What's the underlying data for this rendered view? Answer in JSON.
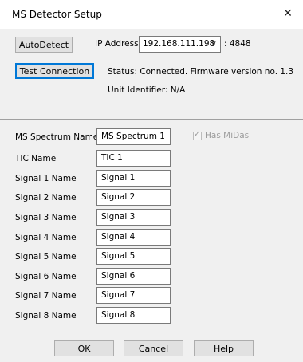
{
  "window": {
    "title": "MS Detector Setup",
    "close_glyph": "✕"
  },
  "connection": {
    "autodetect_label": "AutoDetect",
    "ip_label": "IP Address:",
    "ip_value": "192.168.111.198",
    "port_text": ": 4848",
    "test_label": "Test Connection",
    "status_text": "Status: Connected. Firmware version no. 1.3",
    "unit_text": "Unit Identifier: N/A"
  },
  "names": {
    "spectrum_label": "MS Spectrum Name",
    "spectrum_value": "MS Spectrum 1",
    "has_midas_label": "Has MiDas",
    "has_midas_checked": true,
    "tic_label": "TIC Name",
    "tic_value": "TIC 1",
    "signals": [
      {
        "label": "Signal 1 Name",
        "value": "Signal 1"
      },
      {
        "label": "Signal 2 Name",
        "value": "Signal 2"
      },
      {
        "label": "Signal 3 Name",
        "value": "Signal 3"
      },
      {
        "label": "Signal 4 Name",
        "value": "Signal 4"
      },
      {
        "label": "Signal 5 Name",
        "value": "Signal 5"
      },
      {
        "label": "Signal 6 Name",
        "value": "Signal 6"
      },
      {
        "label": "Signal 7 Name",
        "value": "Signal 7"
      },
      {
        "label": "Signal 8 Name",
        "value": "Signal 8"
      }
    ]
  },
  "footer": {
    "ok_label": "OK",
    "cancel_label": "Cancel",
    "help_label": "Help"
  }
}
